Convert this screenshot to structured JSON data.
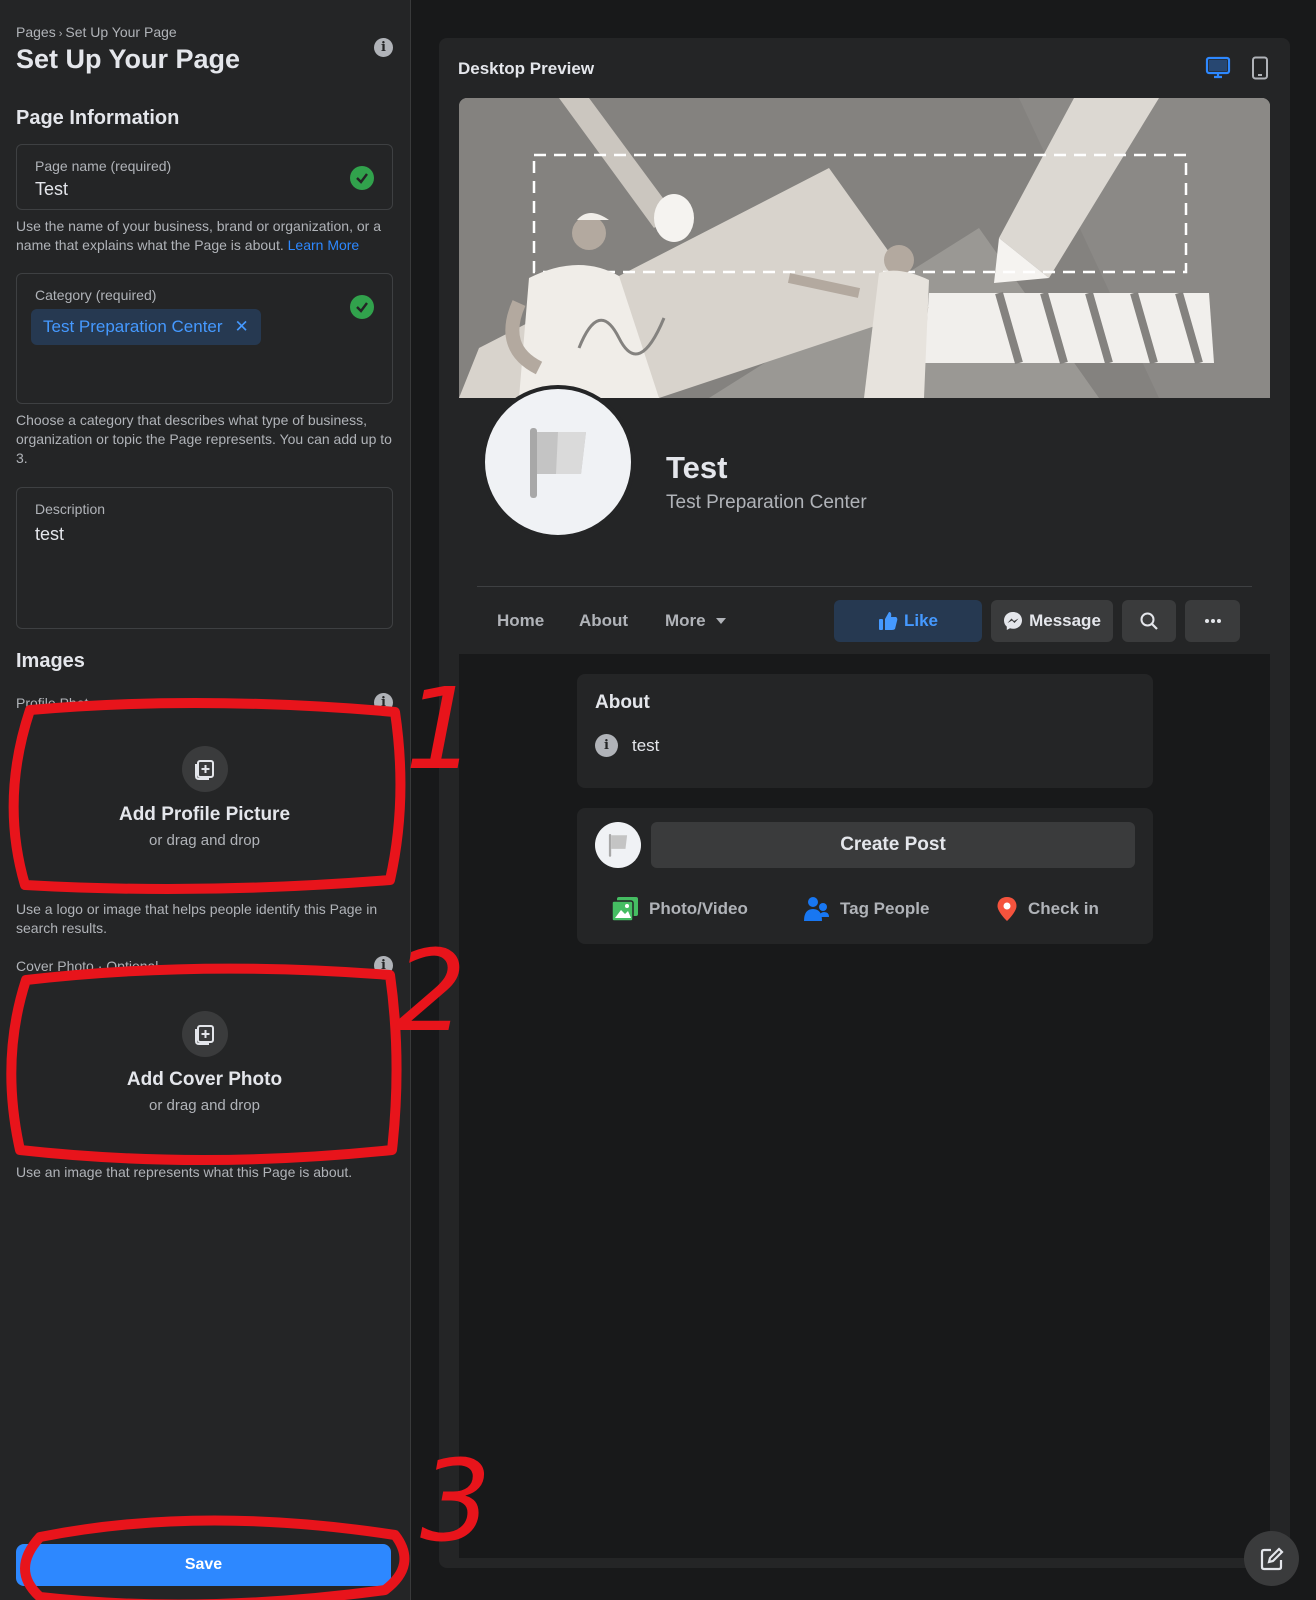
{
  "sidebar": {
    "breadcrumb": {
      "root": "Pages",
      "separator": "›",
      "current": "Set Up Your Page"
    },
    "title": "Set Up Your Page",
    "page_info_title": "Page Information",
    "page_name": {
      "label": "Page name (required)",
      "value": "Test"
    },
    "page_name_helper": "Use the name of your business, brand or organization, or a name that explains what the Page is about.",
    "learn_more": "Learn More",
    "category": {
      "label": "Category (required)",
      "chip": "Test Preparation Center",
      "chip_remove": "✕"
    },
    "category_helper": "Choose a category that describes what type of business, organization or topic the Page represents. You can add up to 3.",
    "description": {
      "label": "Description",
      "value": "test"
    },
    "images_title": "Images",
    "profile_photo": {
      "label": "Profile Phot",
      "title": "Add Profile Picture",
      "subtitle": "or drag and drop",
      "helper": "Use a logo or image that helps people identify this Page in search results."
    },
    "cover_photo": {
      "label": "Cover Photo · Optional",
      "title": "Add Cover Photo",
      "subtitle": "or drag and drop",
      "helper": "Use an image that represents what this Page is about."
    },
    "save_label": "Save"
  },
  "preview": {
    "title": "Desktop Preview",
    "icons": [
      "desktop-icon",
      "mobile-icon"
    ],
    "profile_name": "Test",
    "profile_category": "Test Preparation Center",
    "tabs": [
      "Home",
      "About",
      "More"
    ],
    "buttons": {
      "like": "Like",
      "message": "Message"
    },
    "about": {
      "title": "About",
      "text": "test"
    },
    "create_post": "Create Post",
    "actions": [
      "Photo/Video",
      "Tag People",
      "Check in"
    ]
  },
  "annotations": [
    "1",
    "2",
    "3"
  ],
  "colors": {
    "accent": "#2d88ff",
    "annotation": "#e8141b",
    "success": "#31a24c"
  }
}
